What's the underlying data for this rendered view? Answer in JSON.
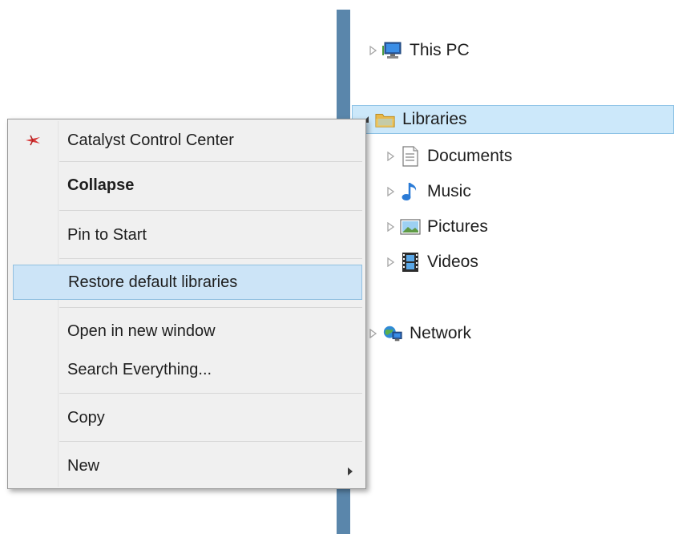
{
  "tree": {
    "items": [
      {
        "label": "This PC",
        "icon": "computer-icon",
        "expander": "collapsed"
      },
      {
        "label": "Libraries",
        "icon": "libraries-folder-icon",
        "expander": "expanded",
        "selected": true
      },
      {
        "label": "Documents",
        "icon": "documents-icon",
        "expander": "collapsed"
      },
      {
        "label": "Music",
        "icon": "music-note-icon",
        "expander": "collapsed"
      },
      {
        "label": "Pictures",
        "icon": "pictures-icon",
        "expander": "collapsed"
      },
      {
        "label": "Videos",
        "icon": "film-icon",
        "expander": "collapsed"
      },
      {
        "label": "Network",
        "icon": "network-icon",
        "expander": "collapsed"
      }
    ]
  },
  "menu": {
    "items": [
      {
        "label": "Catalyst Control Center",
        "icon": "catalyst-icon"
      },
      {
        "label": "Collapse",
        "bold": true
      },
      {
        "label": "Pin to Start"
      },
      {
        "label": "Restore default libraries",
        "highlighted": true
      },
      {
        "label": "Open in new window"
      },
      {
        "label": "Search Everything..."
      },
      {
        "label": "Copy"
      },
      {
        "label": "New",
        "submenu": true
      }
    ]
  },
  "colors": {
    "accent_edge": "#5a86ab",
    "selection_bg": "#cce8fa",
    "menu_bg": "#f0f0f0",
    "menu_hover_bg": "#cce4f7"
  }
}
